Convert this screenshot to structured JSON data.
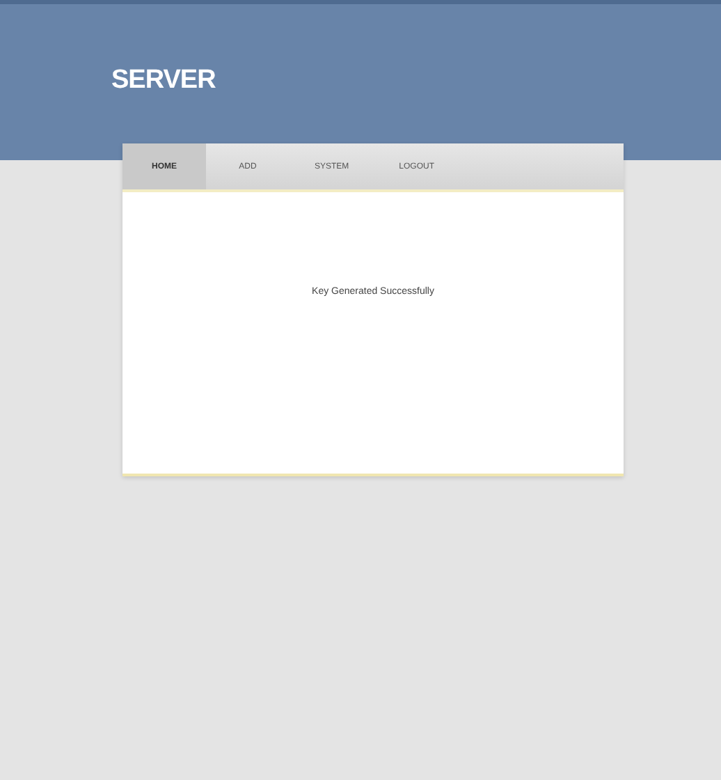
{
  "header": {
    "title": "SERVER"
  },
  "tabs": [
    {
      "label": "HOME",
      "selected": true
    },
    {
      "label": "ADD",
      "selected": false
    },
    {
      "label": "SYSTEM",
      "selected": false
    },
    {
      "label": "LOGOUT",
      "selected": false
    }
  ],
  "message": "Key Generated Successfully"
}
